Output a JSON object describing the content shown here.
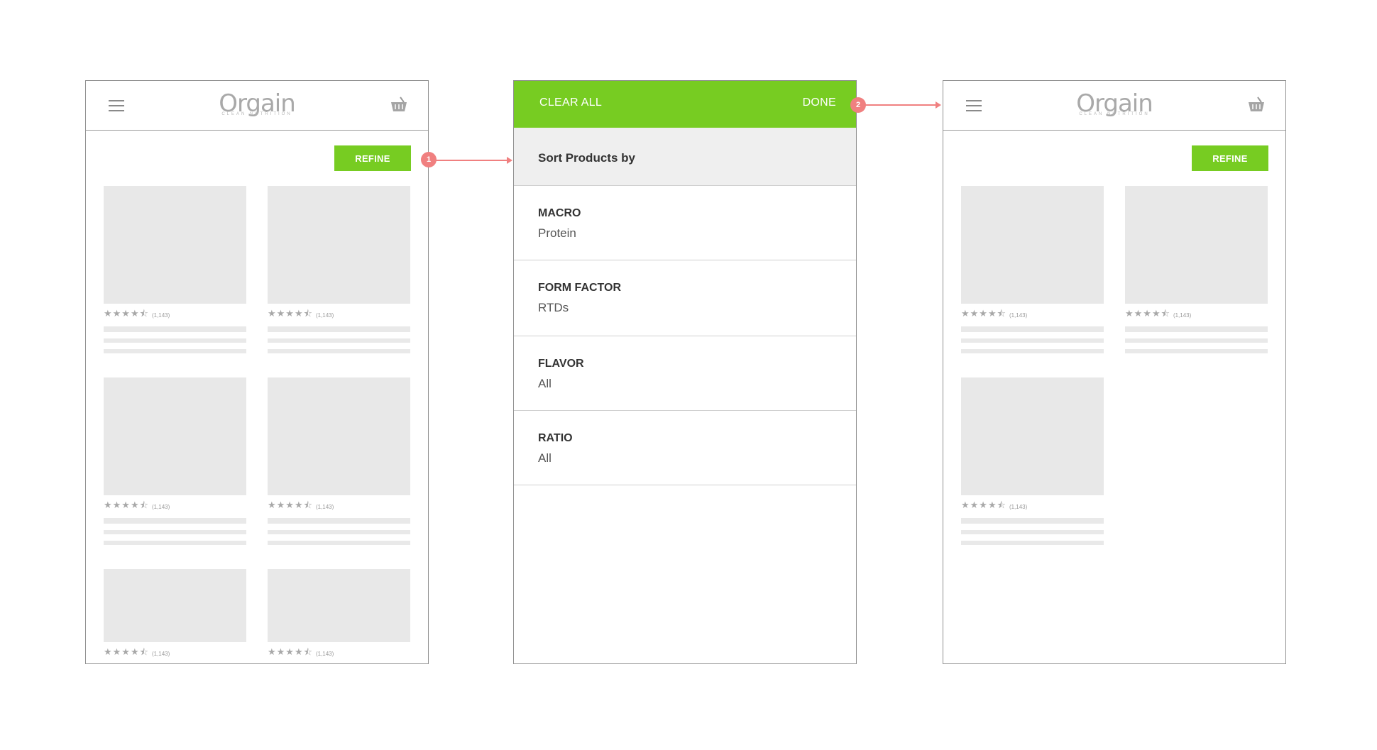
{
  "colors": {
    "accent_green": "#77cc22",
    "placeholder_gray": "#e8e8e8",
    "annotation_pink": "#f08080",
    "frame_border": "#8f8f8f"
  },
  "header": {
    "menu_icon": "hamburger-menu-icon",
    "logo_text": "Orgain",
    "logo_tagline": "CLEAN NUTRITION",
    "cart_icon": "basket-icon"
  },
  "refine_label": "REFINE",
  "rating": {
    "stars": "★★★★⯪",
    "count": "(1,143)"
  },
  "filter_panel": {
    "clear_all_label": "CLEAR ALL",
    "done_label": "DONE",
    "sort_label": "Sort Products by",
    "filters": [
      {
        "title": "MACRO",
        "value": "Protein"
      },
      {
        "title": "FORM FACTOR",
        "value": "RTDs"
      },
      {
        "title": "FLAVOR",
        "value": "All"
      },
      {
        "title": "RATIO",
        "value": "All"
      }
    ]
  },
  "annotations": {
    "step1": "1",
    "step2": "2"
  }
}
